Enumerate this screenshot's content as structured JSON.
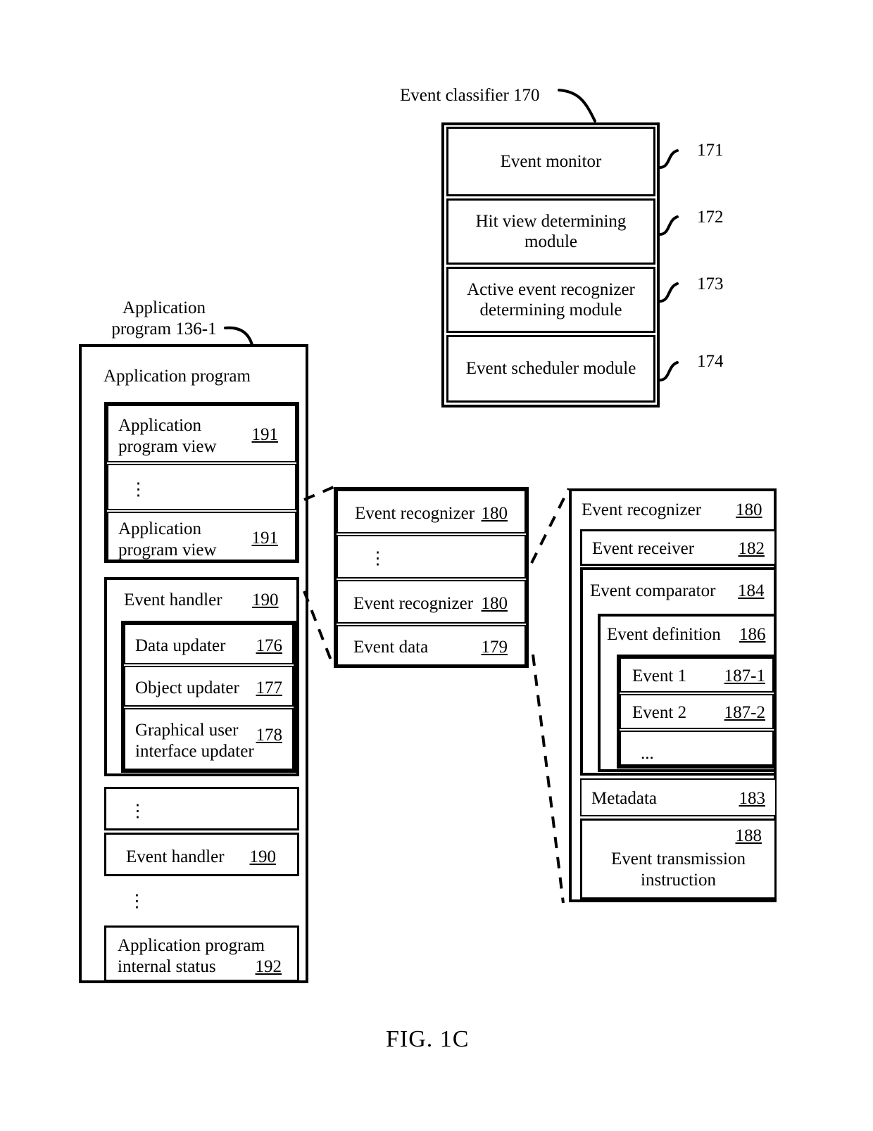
{
  "figure": {
    "caption": "FIG. 1C"
  },
  "event_classifier": {
    "title": "Event classifier 170",
    "rows": [
      {
        "label": "Event monitor",
        "ref": "171"
      },
      {
        "label": "Hit view determining\nmodule",
        "ref": "172"
      },
      {
        "label": "Active event recognizer\ndetermining module",
        "ref": "173"
      },
      {
        "label": "Event scheduler module",
        "ref": "174"
      }
    ]
  },
  "application_program": {
    "title": "Application\nprogram 136-1",
    "header": "Application program",
    "view_1": {
      "label": "Application\nprogram view",
      "ref": "191"
    },
    "ellipsis_1": "⋮",
    "view_2": {
      "label": "Application\nprogram view",
      "ref": "191"
    },
    "event_handler_1": {
      "label": "Event handler",
      "ref": "190",
      "children": [
        {
          "label": "Data updater",
          "ref": "176"
        },
        {
          "label": "Object updater",
          "ref": "177"
        },
        {
          "label": "Graphical user\ninterface updater",
          "ref": "178"
        }
      ]
    },
    "ellipsis_2": "⋮",
    "event_handler_2": {
      "label": "Event handler",
      "ref": "190"
    },
    "ellipsis_3": "⋮",
    "internal_status": {
      "label": "Application program\ninternal status",
      "ref": "192"
    }
  },
  "recognizer_list": {
    "rows": [
      {
        "label": "Event recognizer",
        "ref": "180"
      },
      {
        "label": "⋮",
        "ref": ""
      },
      {
        "label": "Event recognizer",
        "ref": "180"
      },
      {
        "label": "Event data",
        "ref": "179"
      }
    ]
  },
  "recognizer_detail": {
    "title": {
      "label": "Event recognizer",
      "ref": "180"
    },
    "receiver": {
      "label": "Event receiver",
      "ref": "182"
    },
    "comparator": {
      "label": "Event comparator",
      "ref": "184"
    },
    "definition": {
      "label": "Event definition",
      "ref": "186"
    },
    "events": [
      {
        "label": "Event 1",
        "ref": "187-1"
      },
      {
        "label": "Event 2",
        "ref": "187-2"
      },
      {
        "label": "...",
        "ref": ""
      }
    ],
    "metadata": {
      "label": "Metadata",
      "ref": "183"
    },
    "transmission": {
      "label": "Event transmission\ninstruction",
      "ref": "188"
    }
  }
}
